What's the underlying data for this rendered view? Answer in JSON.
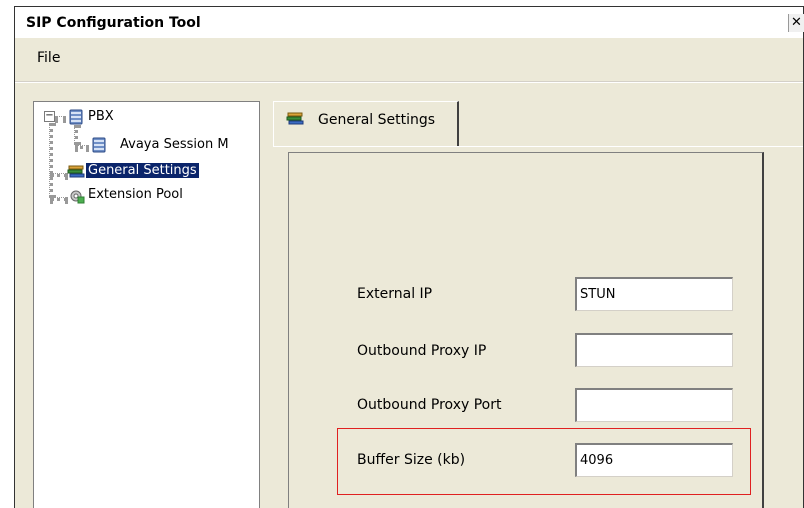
{
  "window": {
    "title": "SIP Configuration Tool",
    "close_glyph": "✕"
  },
  "menu": {
    "items": [
      "File"
    ]
  },
  "tree": {
    "expander_glyph": "−",
    "nodes": [
      {
        "label": "PBX",
        "icon": "database-icon"
      },
      {
        "label": "Avaya Session M",
        "icon": "database-icon"
      },
      {
        "label": "General Settings",
        "icon": "books-icon",
        "selected": true
      },
      {
        "label": "Extension Pool",
        "icon": "gear-puzzle-icon"
      }
    ]
  },
  "tabs": [
    {
      "label": "General Settings",
      "icon": "books-icon",
      "active": true
    }
  ],
  "form": {
    "external_ip": {
      "label": "External IP",
      "value": "STUN"
    },
    "outbound_proxy_ip": {
      "label": "Outbound Proxy IP",
      "value": ""
    },
    "outbound_proxy_port": {
      "label": "Outbound Proxy Port",
      "value": ""
    },
    "buffer_size": {
      "label": "Buffer Size (kb)",
      "value": "4096"
    }
  },
  "colors": {
    "selection": "#0a246a",
    "highlight_box": "#e02020",
    "panel": "#ece9d8"
  }
}
